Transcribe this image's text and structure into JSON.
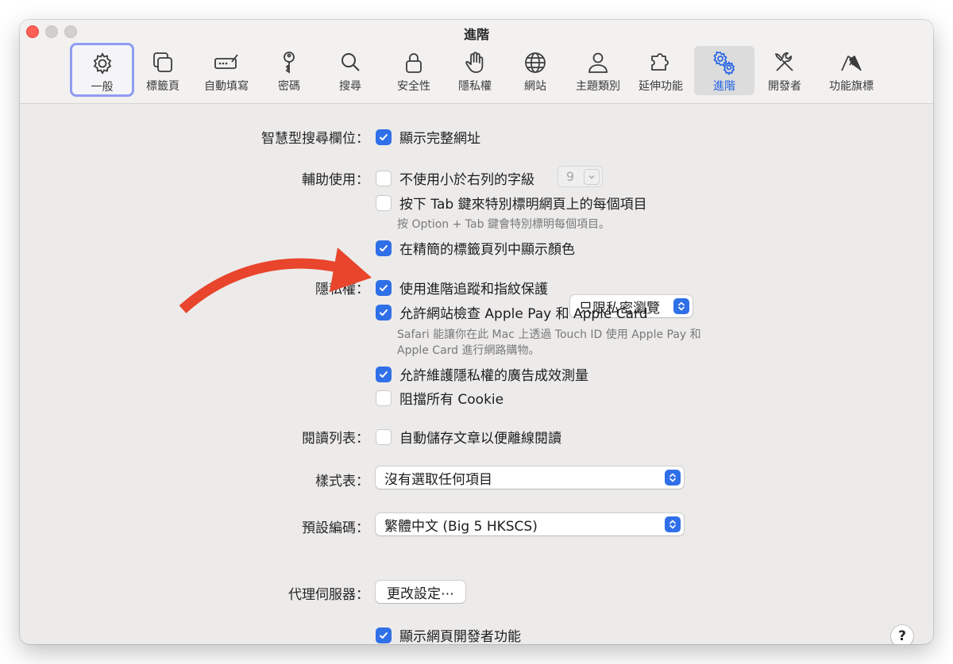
{
  "window": {
    "title": "進階"
  },
  "toolbar": {
    "items": [
      {
        "label": "一般",
        "icon": "gear-icon"
      },
      {
        "label": "標籤頁",
        "icon": "tabs-icon"
      },
      {
        "label": "自動填寫",
        "icon": "autofill-icon"
      },
      {
        "label": "密碼",
        "icon": "key-icon"
      },
      {
        "label": "搜尋",
        "icon": "magnifier-icon"
      },
      {
        "label": "安全性",
        "icon": "lock-icon"
      },
      {
        "label": "隱私權",
        "icon": "hand-icon"
      },
      {
        "label": "網站",
        "icon": "globe-icon"
      },
      {
        "label": "主題類別",
        "icon": "person-icon"
      },
      {
        "label": "延伸功能",
        "icon": "puzzle-icon"
      },
      {
        "label": "進階",
        "icon": "gears-icon"
      },
      {
        "label": "開發者",
        "icon": "tools-icon"
      },
      {
        "label": "功能旗標",
        "icon": "flags-icon"
      }
    ],
    "selected": "進階",
    "focused": "一般"
  },
  "smart_search": {
    "label": "智慧型搜尋欄位：",
    "show_full_url": "顯示完整網址",
    "show_full_url_checked": true
  },
  "accessibility": {
    "label": "輔助使用：",
    "min_font": "不使用小於右列的字級",
    "min_font_checked": false,
    "min_font_value": "9",
    "tab_highlight": "按下 Tab 鍵來特別標明網頁上的每個項目",
    "tab_highlight_checked": false,
    "tab_note": "按 Option + Tab 鍵會特別標明每個項目。",
    "compact_color": "在精簡的標籤頁列中顯示顏色",
    "compact_color_checked": true
  },
  "privacy": {
    "label": "隱私權：",
    "tracking": "使用進階追蹤和指紋保護",
    "tracking_checked": true,
    "tracking_option": "只限私密瀏覽",
    "apple_pay": "允許網站檢查 Apple Pay 和 Apple Card",
    "apple_pay_checked": true,
    "apple_pay_note_1": "Safari 能讓你在此 Mac 上透過 Touch ID 使用 Apple Pay 和",
    "apple_pay_note_2": "Apple Card 進行網路購物。",
    "ad_measure": "允許維護隱私權的廣告成效測量",
    "ad_measure_checked": true,
    "block_cookies": "阻擋所有 Cookie",
    "block_cookies_checked": false
  },
  "reading_list": {
    "label": "閱讀列表：",
    "save_offline": "自動儲存文章以便離線閱讀",
    "save_offline_checked": false
  },
  "stylesheet": {
    "label": "樣式表：",
    "value": "沒有選取任何項目"
  },
  "encoding": {
    "label": "預設編碼：",
    "value": "繁體中文 (Big 5 HKSCS)"
  },
  "proxy": {
    "label": "代理伺服器：",
    "button": "更改設定⋯"
  },
  "developer": {
    "show_dev": "顯示網頁開發者功能",
    "show_dev_checked": true
  },
  "help": {
    "label": "?"
  },
  "colors": {
    "accent": "#2f6fe8",
    "annotation_arrow": "#e8452c",
    "focus_ring": "#8f9cf0"
  }
}
